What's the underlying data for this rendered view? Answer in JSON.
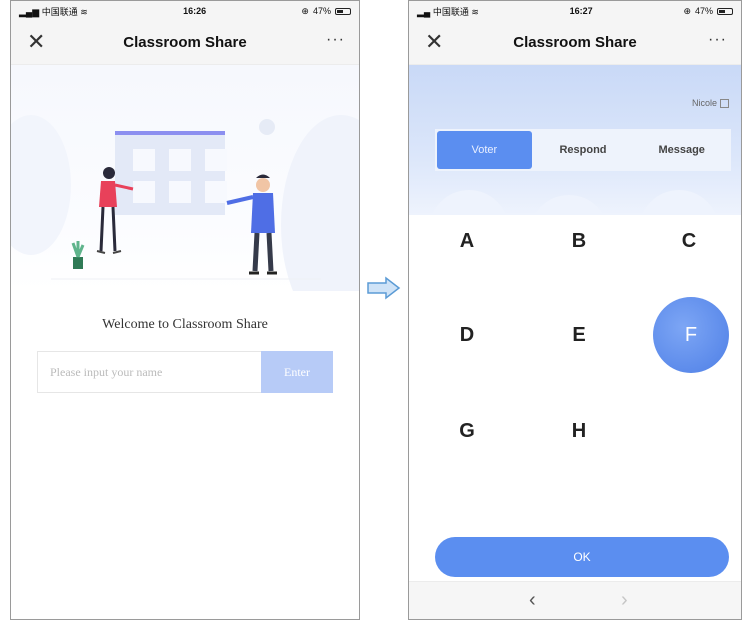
{
  "screen1": {
    "status": {
      "carrier": "中国联通",
      "time": "16:26",
      "battery": "47%"
    },
    "title": "Classroom Share",
    "welcome": "Welcome to Classroom Share",
    "name_placeholder": "Please input your name",
    "enter_label": "Enter"
  },
  "screen2": {
    "status": {
      "carrier": "中国联通",
      "time": "16:27",
      "battery": "47%"
    },
    "title": "Classroom Share",
    "username": "Nicole",
    "tabs": [
      {
        "label": "Voter",
        "active": true
      },
      {
        "label": "Respond",
        "active": false
      },
      {
        "label": "Message",
        "active": false
      }
    ],
    "options": [
      "A",
      "B",
      "C",
      "D",
      "E",
      "F",
      "G",
      "H"
    ],
    "selected_option": "F",
    "ok_label": "OK"
  },
  "colors": {
    "accent": "#5b8ef0",
    "accent_light": "#b7cbf7",
    "band": "#dbe6fa"
  }
}
